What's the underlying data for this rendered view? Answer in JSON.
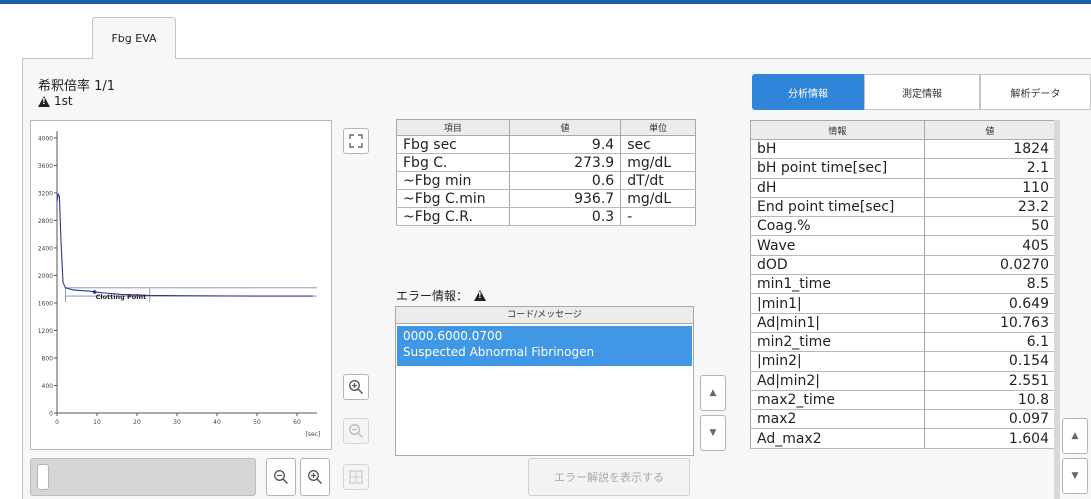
{
  "tab": {
    "label": "Fbg EVA"
  },
  "header": {
    "dilution": "希釈倍率 1/1",
    "run_label": "1st"
  },
  "graph": {
    "annotation": "Clotting Point",
    "x_unit": "[sec]",
    "chart_data": {
      "type": "line",
      "title": "",
      "xlabel": "[sec]",
      "ylabel": "",
      "xlim": [
        0,
        65
      ],
      "ylim": [
        0,
        4100
      ],
      "x_ticks": [
        "0",
        "10",
        "20",
        "30",
        "40",
        "50",
        "60"
      ],
      "y_ticks": [
        "0",
        "400",
        "800",
        "1200",
        "1600",
        "2000",
        "2400",
        "2800",
        "3200",
        "3600",
        "4000"
      ],
      "series": [
        {
          "x": [
            0,
            0.3,
            0.6,
            1.0,
            1.5,
            2.1,
            4,
            6,
            8,
            9.4,
            12,
            16,
            23.2,
            30,
            40,
            50,
            60,
            64
          ],
          "y": [
            3080,
            3180,
            3150,
            2500,
            1900,
            1820,
            1790,
            1780,
            1772,
            1760,
            1745,
            1725,
            1710,
            1705,
            1702,
            1700,
            1700,
            1700
          ]
        }
      ],
      "reference_lines": [
        {
          "orientation": "horizontal",
          "value": 1820
        },
        {
          "orientation": "horizontal",
          "value": 1700
        },
        {
          "orientation": "vertical",
          "value": 2.1
        },
        {
          "orientation": "vertical",
          "value": 23.2
        }
      ],
      "markers": [
        {
          "label": "Clotting Point",
          "x": 9.4,
          "y": 1760
        }
      ]
    }
  },
  "icons": {
    "fullscreen": "fullscreen-icon",
    "zoom_in": "zoom-in-icon",
    "zoom_out": "zoom-out-icon",
    "fit": "fit-view-icon",
    "up": "arrow-up-icon",
    "down": "arrow-down-icon",
    "warning": "warning-icon"
  },
  "results": {
    "columns": [
      "項目",
      "値",
      "単位"
    ],
    "rows": [
      {
        "item": "Fbg sec",
        "value": "9.4",
        "unit": "sec"
      },
      {
        "item": "Fbg C.",
        "value": "273.9",
        "unit": "mg/dL"
      },
      {
        "item": "~Fbg min",
        "value": "0.6",
        "unit": "dT/dt"
      },
      {
        "item": "~Fbg C.min",
        "value": "936.7",
        "unit": "mg/dL"
      },
      {
        "item": "~Fbg C.R.",
        "value": "0.3",
        "unit": "-"
      }
    ]
  },
  "errors": {
    "label": "エラー情報：",
    "column": "コード/メッセージ",
    "items": [
      {
        "code": "0000.6000.0700",
        "message": "Suspected Abnormal Fibrinogen"
      }
    ],
    "show_button": "エラー解説を表示する"
  },
  "right_tabs": [
    "分析情報",
    "測定情報",
    "解析データ"
  ],
  "info": {
    "columns": [
      "情報",
      "値"
    ],
    "rows": [
      {
        "name": "bH",
        "value": "1824"
      },
      {
        "name": "bH point time[sec]",
        "value": "2.1"
      },
      {
        "name": "dH",
        "value": "110"
      },
      {
        "name": "End point time[sec]",
        "value": "23.2"
      },
      {
        "name": "Coag.%",
        "value": "50"
      },
      {
        "name": "Wave",
        "value": "405"
      },
      {
        "name": "dOD",
        "value": "0.0270"
      },
      {
        "name": "min1_time",
        "value": "8.5"
      },
      {
        "name": "|min1|",
        "value": "0.649"
      },
      {
        "name": "Ad|min1|",
        "value": "10.763"
      },
      {
        "name": "min2_time",
        "value": "6.1"
      },
      {
        "name": "|min2|",
        "value": "0.154"
      },
      {
        "name": "Ad|min2|",
        "value": "2.551"
      },
      {
        "name": "max2_time",
        "value": "10.8"
      },
      {
        "name": "max2",
        "value": "0.097"
      },
      {
        "name": "Ad_max2",
        "value": "1.604"
      }
    ]
  }
}
